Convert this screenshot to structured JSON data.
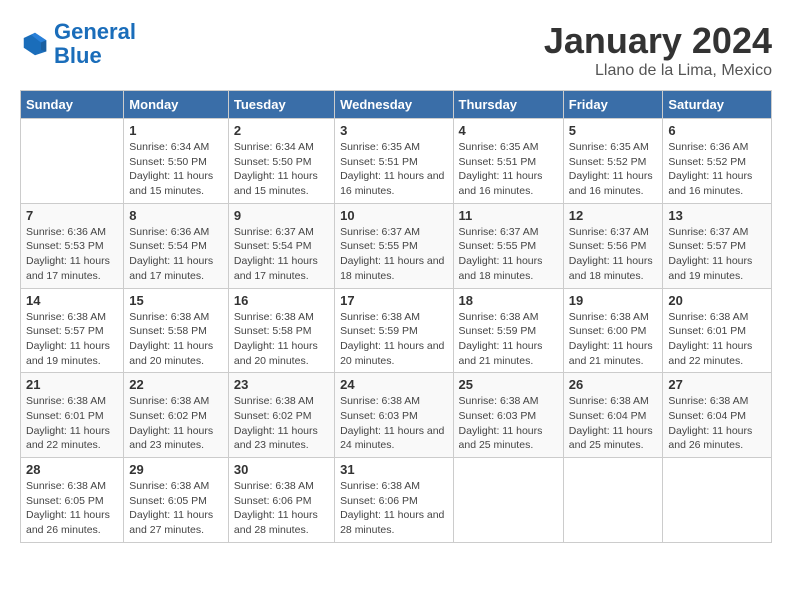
{
  "logo": {
    "text_general": "General",
    "text_blue": "Blue"
  },
  "title": "January 2024",
  "subtitle": "Llano de la Lima, Mexico",
  "days_header": [
    "Sunday",
    "Monday",
    "Tuesday",
    "Wednesday",
    "Thursday",
    "Friday",
    "Saturday"
  ],
  "weeks": [
    [
      {
        "day": "",
        "info": ""
      },
      {
        "day": "1",
        "info": "Sunrise: 6:34 AM\nSunset: 5:50 PM\nDaylight: 11 hours and 15 minutes."
      },
      {
        "day": "2",
        "info": "Sunrise: 6:34 AM\nSunset: 5:50 PM\nDaylight: 11 hours and 15 minutes."
      },
      {
        "day": "3",
        "info": "Sunrise: 6:35 AM\nSunset: 5:51 PM\nDaylight: 11 hours and 16 minutes."
      },
      {
        "day": "4",
        "info": "Sunrise: 6:35 AM\nSunset: 5:51 PM\nDaylight: 11 hours and 16 minutes."
      },
      {
        "day": "5",
        "info": "Sunrise: 6:35 AM\nSunset: 5:52 PM\nDaylight: 11 hours and 16 minutes."
      },
      {
        "day": "6",
        "info": "Sunrise: 6:36 AM\nSunset: 5:52 PM\nDaylight: 11 hours and 16 minutes."
      }
    ],
    [
      {
        "day": "7",
        "info": "Sunrise: 6:36 AM\nSunset: 5:53 PM\nDaylight: 11 hours and 17 minutes."
      },
      {
        "day": "8",
        "info": "Sunrise: 6:36 AM\nSunset: 5:54 PM\nDaylight: 11 hours and 17 minutes."
      },
      {
        "day": "9",
        "info": "Sunrise: 6:37 AM\nSunset: 5:54 PM\nDaylight: 11 hours and 17 minutes."
      },
      {
        "day": "10",
        "info": "Sunrise: 6:37 AM\nSunset: 5:55 PM\nDaylight: 11 hours and 18 minutes."
      },
      {
        "day": "11",
        "info": "Sunrise: 6:37 AM\nSunset: 5:55 PM\nDaylight: 11 hours and 18 minutes."
      },
      {
        "day": "12",
        "info": "Sunrise: 6:37 AM\nSunset: 5:56 PM\nDaylight: 11 hours and 18 minutes."
      },
      {
        "day": "13",
        "info": "Sunrise: 6:37 AM\nSunset: 5:57 PM\nDaylight: 11 hours and 19 minutes."
      }
    ],
    [
      {
        "day": "14",
        "info": "Sunrise: 6:38 AM\nSunset: 5:57 PM\nDaylight: 11 hours and 19 minutes."
      },
      {
        "day": "15",
        "info": "Sunrise: 6:38 AM\nSunset: 5:58 PM\nDaylight: 11 hours and 20 minutes."
      },
      {
        "day": "16",
        "info": "Sunrise: 6:38 AM\nSunset: 5:58 PM\nDaylight: 11 hours and 20 minutes."
      },
      {
        "day": "17",
        "info": "Sunrise: 6:38 AM\nSunset: 5:59 PM\nDaylight: 11 hours and 20 minutes."
      },
      {
        "day": "18",
        "info": "Sunrise: 6:38 AM\nSunset: 5:59 PM\nDaylight: 11 hours and 21 minutes."
      },
      {
        "day": "19",
        "info": "Sunrise: 6:38 AM\nSunset: 6:00 PM\nDaylight: 11 hours and 21 minutes."
      },
      {
        "day": "20",
        "info": "Sunrise: 6:38 AM\nSunset: 6:01 PM\nDaylight: 11 hours and 22 minutes."
      }
    ],
    [
      {
        "day": "21",
        "info": "Sunrise: 6:38 AM\nSunset: 6:01 PM\nDaylight: 11 hours and 22 minutes."
      },
      {
        "day": "22",
        "info": "Sunrise: 6:38 AM\nSunset: 6:02 PM\nDaylight: 11 hours and 23 minutes."
      },
      {
        "day": "23",
        "info": "Sunrise: 6:38 AM\nSunset: 6:02 PM\nDaylight: 11 hours and 23 minutes."
      },
      {
        "day": "24",
        "info": "Sunrise: 6:38 AM\nSunset: 6:03 PM\nDaylight: 11 hours and 24 minutes."
      },
      {
        "day": "25",
        "info": "Sunrise: 6:38 AM\nSunset: 6:03 PM\nDaylight: 11 hours and 25 minutes."
      },
      {
        "day": "26",
        "info": "Sunrise: 6:38 AM\nSunset: 6:04 PM\nDaylight: 11 hours and 25 minutes."
      },
      {
        "day": "27",
        "info": "Sunrise: 6:38 AM\nSunset: 6:04 PM\nDaylight: 11 hours and 26 minutes."
      }
    ],
    [
      {
        "day": "28",
        "info": "Sunrise: 6:38 AM\nSunset: 6:05 PM\nDaylight: 11 hours and 26 minutes."
      },
      {
        "day": "29",
        "info": "Sunrise: 6:38 AM\nSunset: 6:05 PM\nDaylight: 11 hours and 27 minutes."
      },
      {
        "day": "30",
        "info": "Sunrise: 6:38 AM\nSunset: 6:06 PM\nDaylight: 11 hours and 28 minutes."
      },
      {
        "day": "31",
        "info": "Sunrise: 6:38 AM\nSunset: 6:06 PM\nDaylight: 11 hours and 28 minutes."
      },
      {
        "day": "",
        "info": ""
      },
      {
        "day": "",
        "info": ""
      },
      {
        "day": "",
        "info": ""
      }
    ]
  ]
}
